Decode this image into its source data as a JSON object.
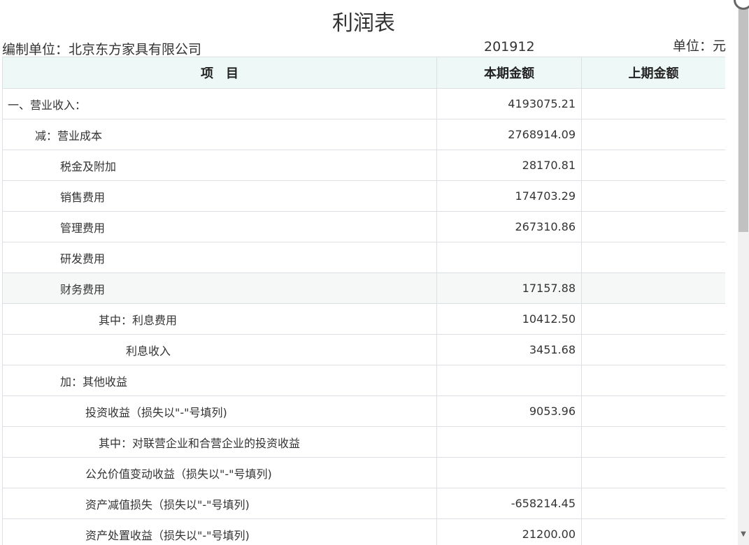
{
  "title": "利润表",
  "meta": {
    "company": "编制单位：北京东方家具有限公司",
    "period": "201912",
    "unit": "单位：元"
  },
  "headers": [
    "项　目",
    "本期金额",
    "上期金额"
  ],
  "rows": [
    {
      "label": "一、营业收入：",
      "current": "4193075.21",
      "previous": ""
    },
    {
      "label": "减：营业成本",
      "current": "2768914.09",
      "previous": ""
    },
    {
      "label": "税金及附加",
      "current": "28170.81",
      "previous": ""
    },
    {
      "label": "销售费用",
      "current": "174703.29",
      "previous": ""
    },
    {
      "label": "管理费用",
      "current": "267310.86",
      "previous": ""
    },
    {
      "label": "研发费用",
      "current": "",
      "previous": ""
    },
    {
      "label": "财务费用",
      "current": "17157.88",
      "previous": ""
    },
    {
      "label": "其中：利息费用",
      "current": "10412.50",
      "previous": ""
    },
    {
      "label": "利息收入",
      "current": "3451.68",
      "previous": ""
    },
    {
      "label": "加：其他收益",
      "current": "",
      "previous": ""
    },
    {
      "label": "投资收益（损失以\"-\"号填列)",
      "current": "9053.96",
      "previous": ""
    },
    {
      "label": "其中：对联营企业和合营企业的投资收益",
      "current": "",
      "previous": ""
    },
    {
      "label": "公允价值变动收益（损失以\"-\"号填列)",
      "current": "",
      "previous": ""
    },
    {
      "label": "资产减值损失（损失以\"-\"号填列)",
      "current": "-658214.45",
      "previous": ""
    },
    {
      "label": "资产处置收益（损失以\"-\"号填列)",
      "current": "21200.00",
      "previous": ""
    }
  ]
}
